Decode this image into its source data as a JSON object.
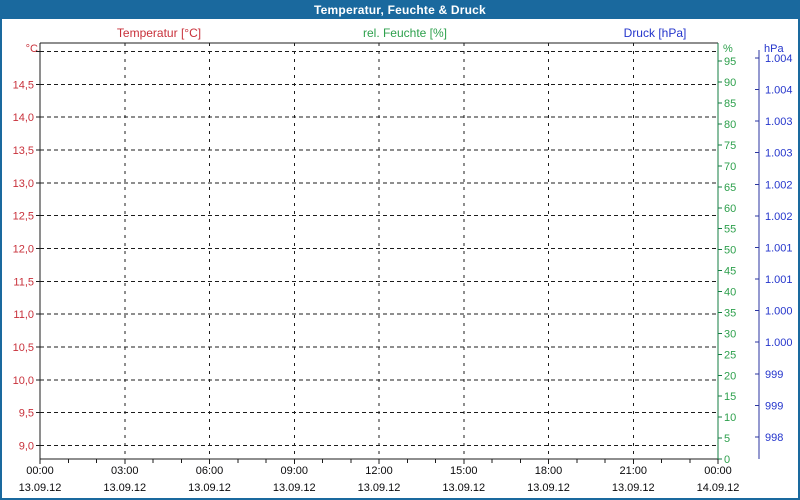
{
  "window": {
    "title": "Temperatur, Feuchte & Druck"
  },
  "colors": {
    "chrome": "#1A699E",
    "background": "#FFFFFF",
    "temperature": "#C8303A",
    "humidity": "#2DA04C",
    "humidity_axis_line": "#137D41",
    "pressure": "#2435CC",
    "pressure_axis_line": "#2B35A0",
    "grid": "#1C1C1C",
    "text": "#0A0A0C"
  },
  "legend": {
    "items": [
      {
        "label": "Temperatur [°C]",
        "color": "#C8303A"
      },
      {
        "label": "rel. Feuchte [%]",
        "color": "#2DA04C"
      },
      {
        "label": "Druck [hPa]",
        "color": "#2435CC"
      }
    ]
  },
  "chart_data": {
    "type": "line",
    "title": "Temperatur, Feuchte & Druck",
    "grid": true,
    "plot_empty": true,
    "x_axis": {
      "tick_labels": [
        "00:00",
        "03:00",
        "06:00",
        "09:00",
        "12:00",
        "15:00",
        "18:00",
        "21:00",
        "00:00"
      ],
      "date_labels": [
        "13.09.12",
        "13.09.12",
        "13.09.12",
        "13.09.12",
        "13.09.12",
        "13.09.12",
        "13.09.12",
        "13.09.12",
        "14.09.12"
      ],
      "tick_interval_hours": 3,
      "minor_tick_interval_hours": 1
    },
    "y_axes": [
      {
        "name": "Temperatur",
        "unit": "°C",
        "side": "left",
        "unlabeled_top_gridline": true,
        "tick_labels": [
          "14,5",
          "14,0",
          "13,5",
          "13,0",
          "12,5",
          "12,0",
          "11,5",
          "11,0",
          "10,5",
          "10,0",
          "9,5",
          "9,0"
        ]
      },
      {
        "name": "rel. Feuchte",
        "unit": "%",
        "side": "right",
        "tick_labels": [
          "95",
          "90",
          "85",
          "80",
          "75",
          "70",
          "65",
          "60",
          "55",
          "50",
          "45",
          "40",
          "35",
          "30",
          "25",
          "20",
          "15",
          "10",
          "5",
          "0"
        ]
      },
      {
        "name": "Druck",
        "unit": "hPa",
        "side": "far-right",
        "tick_labels": [
          "1.004",
          "1.004",
          "1.003",
          "1.003",
          "1.002",
          "1.002",
          "1.001",
          "1.001",
          "1.000",
          "1.000",
          "999",
          "999",
          "998"
        ]
      }
    ],
    "series": [
      {
        "name": "Temperatur [°C]",
        "values": []
      },
      {
        "name": "rel. Feuchte [%]",
        "values": []
      },
      {
        "name": "Druck [hPa]",
        "values": []
      }
    ]
  }
}
